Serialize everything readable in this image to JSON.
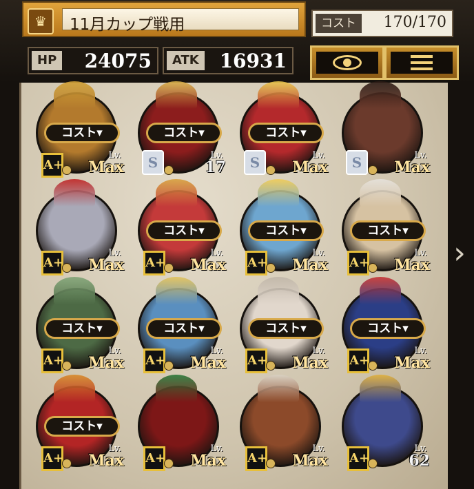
{
  "header": {
    "deck_name": "11月カップ戦用",
    "cost_label": "コスト",
    "cost_value": "170/170",
    "hp_label": "HP",
    "hp_value": "24075",
    "atk_label": "ATK",
    "atk_value": "16931",
    "view_icon": "eye-icon",
    "menu_icon": "menu-icon"
  },
  "cards": [
    {
      "cost": "コスト▾",
      "badge": "A+",
      "lv_label": "Lv.",
      "lv": "Max",
      "color": "#b37a2d",
      "crest": "#d0a035"
    },
    {
      "cost": "コスト▾",
      "badge": "S",
      "lv_label": "Lv.",
      "lv": "17",
      "color": "#8c1d1d",
      "crest": "#d9b24a"
    },
    {
      "cost": "コスト▾",
      "badge": "S",
      "lv_label": "Lv.",
      "lv": "Max",
      "color": "#b4292c",
      "crest": "#e9c84c"
    },
    {
      "cost": "",
      "badge": "S",
      "lv_label": "Lv.",
      "lv": "Max",
      "color": "#6b3a2c",
      "crest": "#2a1a14"
    },
    {
      "cost": "",
      "badge": "A+",
      "lv_label": "Lv.",
      "lv": "Max",
      "color": "#a9a9b7",
      "crest": "#c02424"
    },
    {
      "cost": "コスト▾",
      "badge": "A+",
      "lv_label": "Lv.",
      "lv": "Max",
      "color": "#c43a3a",
      "crest": "#d8a13e"
    },
    {
      "cost": "コスト▾",
      "badge": "A+",
      "lv_label": "Lv.",
      "lv": "Max",
      "color": "#6ea6cf",
      "crest": "#f0cc56"
    },
    {
      "cost": "コスト▾",
      "badge": "A+",
      "lv_label": "Lv.",
      "lv": "Max",
      "color": "#d6c2a2",
      "crest": "#e6e2dc"
    },
    {
      "cost": "コスト▾",
      "badge": "A+",
      "lv_label": "Lv.",
      "lv": "Max",
      "color": "#4d6a45",
      "crest": "#82a678"
    },
    {
      "cost": "コスト▾",
      "badge": "A+",
      "lv_label": "Lv.",
      "lv": "Max",
      "color": "#5a8fbf",
      "crest": "#e3c35a"
    },
    {
      "cost": "コスト▾",
      "badge": "A+",
      "lv_label": "Lv.",
      "lv": "Max",
      "color": "#e1d7cc",
      "crest": "#c0b6a8"
    },
    {
      "cost": "コスト▾",
      "badge": "A+",
      "lv_label": "Lv.",
      "lv": "Max",
      "color": "#2b3e86",
      "crest": "#c73434"
    },
    {
      "cost": "コスト▾",
      "badge": "A+",
      "lv_label": "Lv.",
      "lv": "Max",
      "color": "#b32525",
      "crest": "#d88a2a"
    },
    {
      "cost": "",
      "badge": "A+",
      "lv_label": "Lv.",
      "lv": "Max",
      "color": "#7d1717",
      "crest": "#2a7a3a"
    },
    {
      "cost": "",
      "badge": "A+",
      "lv_label": "Lv.",
      "lv": "Max",
      "color": "#8c4a2a",
      "crest": "#d9d1c3"
    },
    {
      "cost": "",
      "badge": "A+",
      "lv_label": "Lv.",
      "lv": "62",
      "color": "#3e4a8c",
      "crest": "#e0b03c"
    }
  ]
}
